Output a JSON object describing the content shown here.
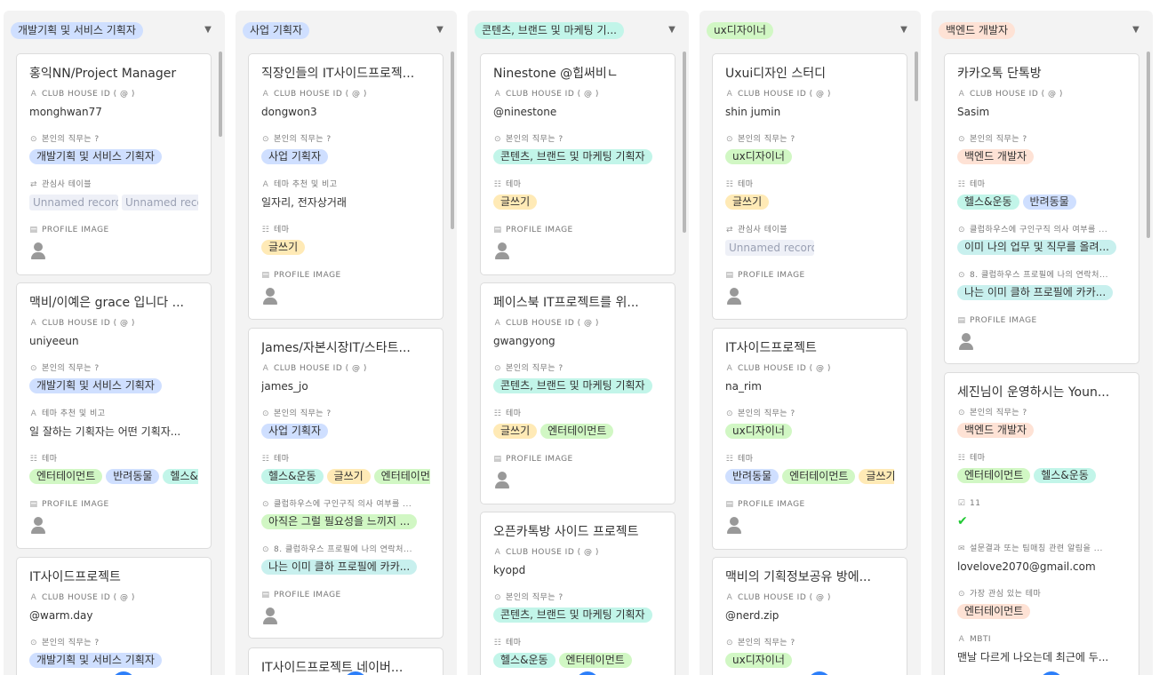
{
  "field_labels": {
    "club_house_id": "CLUB HOUSE ID ( @ )",
    "role": "본인의 직무는 ?",
    "interest_table": "관심사 테이블",
    "theme_note": "테마 추천 및 비고",
    "theme": "테마",
    "profile_image": "PROFILE IMAGE",
    "intent": "클럽하우스에 구인구직 의사 여부를 ...",
    "contact": "8. 클럽하우스 프로필에 나의 연락처...",
    "eleven": "11",
    "survey": "설문결과 또는 팀매칭 관련 알림을 ...",
    "top_interest": "가장 관심 있는 테마",
    "mbti": "MBTI"
  },
  "colors": {
    "blue": "#cfdfff",
    "cyan": "#c2f5e9",
    "green": "#d1f7c4",
    "yellow": "#ffeab6",
    "orange": "#fee2d5",
    "teal": "#c8f0ee",
    "gray": "#eef0f7",
    "check": "#20c933",
    "add_button": "#2d7ff9"
  },
  "icons": {
    "text_field": "text-icon",
    "single_select": "single-select-icon",
    "multi_select": "multi-select-icon",
    "link": "link-record-icon",
    "attachment": "attachment-icon",
    "checkbox": "checkbox-icon",
    "email": "email-icon"
  },
  "columns": [
    {
      "header": "개발기획 및 서비스 기획자",
      "header_color": "blue",
      "cards": [
        {
          "title": "홍익NN/Project Manager",
          "fields": [
            {
              "key": "club_house_id",
              "icon": "text_field",
              "value": "monghwan77"
            },
            {
              "key": "role",
              "icon": "single_select",
              "pills": [
                {
                  "text": "개발기획 및 서비스 기획자",
                  "color": "blue"
                }
              ]
            },
            {
              "key": "interest_table",
              "icon": "link",
              "chips": [
                "Unnamed record",
                "Unnamed record"
              ]
            },
            {
              "key": "profile_image",
              "icon": "attachment",
              "avatar": true
            }
          ]
        },
        {
          "title": "맥비/이예은 grace 입니다 ...",
          "fields": [
            {
              "key": "club_house_id",
              "icon": "text_field",
              "value": "uniyeeun"
            },
            {
              "key": "role",
              "icon": "single_select",
              "pills": [
                {
                  "text": "개발기획 및 서비스 기획자",
                  "color": "blue"
                }
              ]
            },
            {
              "key": "theme_note",
              "icon": "text_field",
              "value": "일 잘하는 기획자는 어떤 기획자..."
            },
            {
              "key": "theme",
              "icon": "multi_select",
              "pills": [
                {
                  "text": "엔터테이먼트",
                  "color": "green"
                },
                {
                  "text": "반려동물",
                  "color": "blue"
                },
                {
                  "text": "헬스&운동",
                  "color": "cyan"
                }
              ]
            },
            {
              "key": "profile_image",
              "icon": "attachment",
              "avatar": true
            }
          ]
        },
        {
          "title": "IT사이드프로젝트",
          "fields": [
            {
              "key": "club_house_id",
              "icon": "text_field",
              "value": "@warm.day"
            },
            {
              "key": "role",
              "icon": "single_select",
              "pills": [
                {
                  "text": "개발기획 및 서비스 기획자",
                  "color": "blue"
                }
              ]
            }
          ]
        }
      ]
    },
    {
      "header": "사업 기획자",
      "header_color": "blue",
      "cards": [
        {
          "title": "직장인들의 IT사이드프로젝...",
          "fields": [
            {
              "key": "club_house_id",
              "icon": "text_field",
              "value": "dongwon3"
            },
            {
              "key": "role",
              "icon": "single_select",
              "pills": [
                {
                  "text": "사업 기획자",
                  "color": "blue"
                }
              ]
            },
            {
              "key": "theme_note",
              "icon": "text_field",
              "value": "일자리, 전자상거래"
            },
            {
              "key": "theme",
              "icon": "multi_select",
              "pills": [
                {
                  "text": "글쓰기",
                  "color": "yellow"
                }
              ]
            },
            {
              "key": "profile_image",
              "icon": "attachment",
              "avatar": true
            }
          ]
        },
        {
          "title": "James/자본시장IT/스타트...",
          "fields": [
            {
              "key": "club_house_id",
              "icon": "text_field",
              "value": "james_jo"
            },
            {
              "key": "role",
              "icon": "single_select",
              "pills": [
                {
                  "text": "사업 기획자",
                  "color": "blue"
                }
              ]
            },
            {
              "key": "theme",
              "icon": "multi_select",
              "pills": [
                {
                  "text": "헬스&운동",
                  "color": "cyan"
                },
                {
                  "text": "글쓰기",
                  "color": "yellow"
                },
                {
                  "text": "엔터테이먼트",
                  "color": "green"
                }
              ]
            },
            {
              "key": "intent",
              "icon": "single_select",
              "pills": [
                {
                  "text": "아직은 그럴 필요성을 느끼지 ...",
                  "color": "green"
                }
              ]
            },
            {
              "key": "contact",
              "icon": "single_select",
              "pills": [
                {
                  "text": "나는 이미 클하 프로필에 카카...",
                  "color": "teal"
                }
              ]
            },
            {
              "key": "profile_image",
              "icon": "attachment",
              "avatar": true
            }
          ]
        },
        {
          "title": "IT사이드프로젝트 네이버...",
          "fields": []
        }
      ]
    },
    {
      "header": "콘텐츠, 브랜드 및 마케팅 기...",
      "header_color": "cyan",
      "cards": [
        {
          "title": "Ninestone @힙써비ㄴ",
          "fields": [
            {
              "key": "club_house_id",
              "icon": "text_field",
              "value": "@ninestone"
            },
            {
              "key": "role",
              "icon": "single_select",
              "pills": [
                {
                  "text": "콘텐츠, 브랜드 및 마케팅 기획자",
                  "color": "cyan"
                }
              ]
            },
            {
              "key": "theme",
              "icon": "multi_select",
              "pills": [
                {
                  "text": "글쓰기",
                  "color": "yellow"
                }
              ]
            },
            {
              "key": "profile_image",
              "icon": "attachment",
              "avatar": true
            }
          ]
        },
        {
          "title": "페이스북 IT프로젝트를 위...",
          "fields": [
            {
              "key": "club_house_id",
              "icon": "text_field",
              "value": "gwangyong"
            },
            {
              "key": "role",
              "icon": "single_select",
              "pills": [
                {
                  "text": "콘텐츠, 브랜드 및 마케팅 기획자",
                  "color": "cyan"
                }
              ]
            },
            {
              "key": "theme",
              "icon": "multi_select",
              "pills": [
                {
                  "text": "글쓰기",
                  "color": "yellow"
                },
                {
                  "text": "엔터테이먼트",
                  "color": "green"
                }
              ]
            },
            {
              "key": "profile_image",
              "icon": "attachment",
              "avatar": true
            }
          ]
        },
        {
          "title": "오픈카톡방 사이드 프로젝트",
          "fields": [
            {
              "key": "club_house_id",
              "icon": "text_field",
              "value": "kyopd"
            },
            {
              "key": "role",
              "icon": "single_select",
              "pills": [
                {
                  "text": "콘텐츠, 브랜드 및 마케팅 기획자",
                  "color": "cyan"
                }
              ]
            },
            {
              "key": "theme",
              "icon": "multi_select",
              "pills": [
                {
                  "text": "헬스&운동",
                  "color": "cyan"
                },
                {
                  "text": "엔터테이먼트",
                  "color": "green"
                }
              ]
            }
          ]
        }
      ]
    },
    {
      "header": "ux디자이너",
      "header_color": "green",
      "cards": [
        {
          "title": "Uxui디자인 스터디",
          "fields": [
            {
              "key": "club_house_id",
              "icon": "text_field",
              "value": "shin jumin"
            },
            {
              "key": "role",
              "icon": "single_select",
              "pills": [
                {
                  "text": "ux디자이너",
                  "color": "green"
                }
              ]
            },
            {
              "key": "theme",
              "icon": "multi_select",
              "pills": [
                {
                  "text": "글쓰기",
                  "color": "yellow"
                }
              ]
            },
            {
              "key": "interest_table",
              "icon": "link",
              "chips": [
                "Unnamed record"
              ]
            },
            {
              "key": "profile_image",
              "icon": "attachment",
              "avatar": true
            }
          ]
        },
        {
          "title": "IT사이드프로젝트",
          "fields": [
            {
              "key": "club_house_id",
              "icon": "text_field",
              "value": "na_rim"
            },
            {
              "key": "role",
              "icon": "single_select",
              "pills": [
                {
                  "text": "ux디자이너",
                  "color": "green"
                }
              ]
            },
            {
              "key": "theme",
              "icon": "multi_select",
              "pills": [
                {
                  "text": "반려동물",
                  "color": "blue"
                },
                {
                  "text": "엔터테이먼트",
                  "color": "green"
                },
                {
                  "text": "글쓰기",
                  "color": "yellow"
                }
              ]
            },
            {
              "key": "profile_image",
              "icon": "attachment",
              "avatar": true
            }
          ]
        },
        {
          "title": "맥비의 기획정보공유 방에...",
          "fields": [
            {
              "key": "club_house_id",
              "icon": "text_field",
              "value": "@nerd.zip"
            },
            {
              "key": "role",
              "icon": "single_select",
              "pills": [
                {
                  "text": "ux디자이너",
                  "color": "green"
                }
              ]
            }
          ]
        }
      ]
    },
    {
      "header": "백엔드 개발자",
      "header_color": "orange",
      "cards": [
        {
          "title": "카카오톡 단톡방",
          "fields": [
            {
              "key": "club_house_id",
              "icon": "text_field",
              "value": "Sasim"
            },
            {
              "key": "role",
              "icon": "single_select",
              "pills": [
                {
                  "text": "백엔드 개발자",
                  "color": "orange"
                }
              ]
            },
            {
              "key": "theme",
              "icon": "multi_select",
              "pills": [
                {
                  "text": "헬스&운동",
                  "color": "cyan"
                },
                {
                  "text": "반려동물",
                  "color": "blue"
                }
              ]
            },
            {
              "key": "intent",
              "icon": "single_select",
              "pills": [
                {
                  "text": "이미 나의 업무 및 직무를 올려...",
                  "color": "teal"
                }
              ]
            },
            {
              "key": "contact",
              "icon": "single_select",
              "pills": [
                {
                  "text": "나는 이미 클하 프로필에 카카...",
                  "color": "teal"
                }
              ]
            },
            {
              "key": "profile_image",
              "icon": "attachment",
              "avatar": true
            }
          ]
        },
        {
          "title": "세진님이 운영하시는 Youn...",
          "fields": [
            {
              "key": "role",
              "icon": "single_select",
              "pills": [
                {
                  "text": "백엔드 개발자",
                  "color": "orange"
                }
              ]
            },
            {
              "key": "theme",
              "icon": "multi_select",
              "pills": [
                {
                  "text": "엔터테이먼트",
                  "color": "green"
                },
                {
                  "text": "헬스&운동",
                  "color": "cyan"
                }
              ]
            },
            {
              "key": "eleven",
              "icon": "checkbox",
              "check": true
            },
            {
              "key": "survey",
              "icon": "email",
              "value": "lovelove2070@gmail.com"
            },
            {
              "key": "top_interest",
              "icon": "single_select",
              "pills": [
                {
                  "text": "엔터테이먼트",
                  "color": "orange"
                }
              ]
            },
            {
              "key": "mbti",
              "icon": "text_field",
              "value": "맨날 다르게 나오는데 최근에 두..."
            }
          ]
        }
      ]
    }
  ]
}
